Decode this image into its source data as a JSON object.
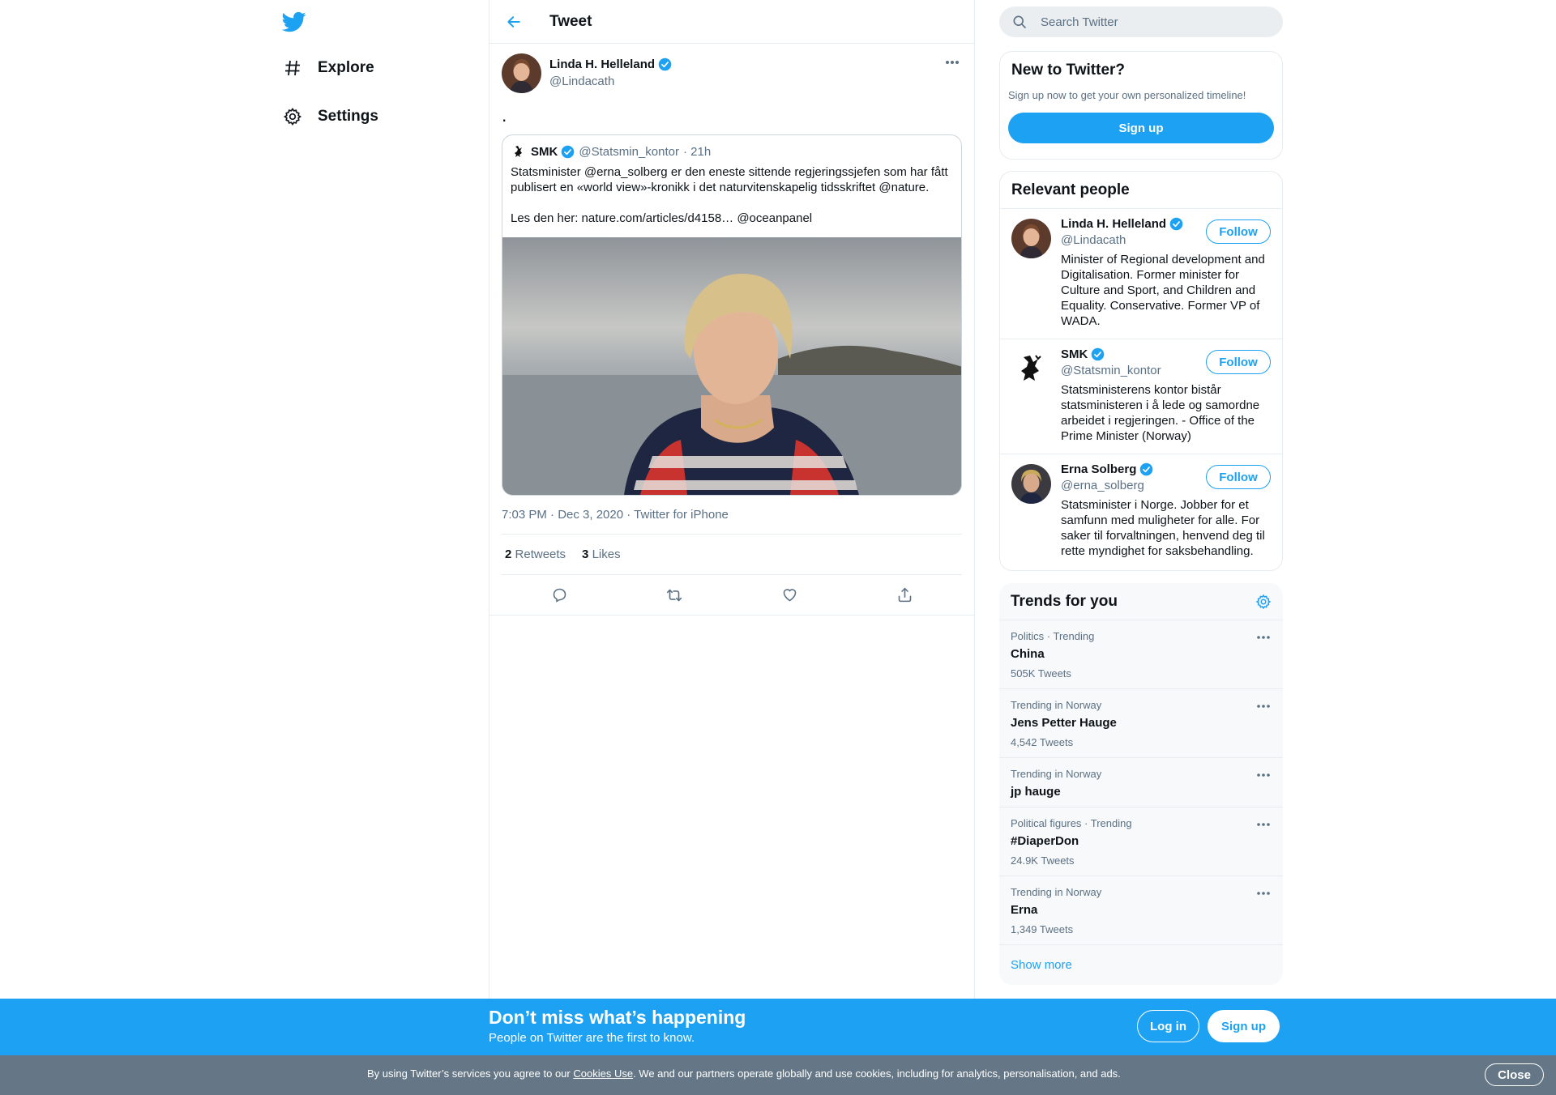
{
  "nav": {
    "logo_icon": "twitter-bird-icon",
    "items": [
      {
        "label": "Explore",
        "icon": "hashtag-icon"
      },
      {
        "label": "Settings",
        "icon": "gear-icon"
      }
    ]
  },
  "header": {
    "title": "Tweet",
    "back_icon": "arrow-left-icon"
  },
  "tweet": {
    "author_name": "Linda H. Helleland",
    "author_handle": "@Lindacath",
    "text": ".",
    "quote": {
      "name": "SMK",
      "handle": "@Statsmin_kontor",
      "time": "· 21h",
      "text_1": "Statsminister @erna_solberg er den eneste sittende regjeringssjefen som har fått publisert en «world view»-kronikk i det naturvitenskapelig tidsskriftet @nature.",
      "text_2": "Les den her: nature.com/articles/d4158… @oceanpanel"
    },
    "timestamp": "7:03 PM · Dec 3, 2020",
    "separator": "·",
    "source": "Twitter for iPhone",
    "retweets_count": "2",
    "retweets_label": "Retweets",
    "likes_count": "3",
    "likes_label": "Likes"
  },
  "search": {
    "placeholder": "Search Twitter"
  },
  "new_to_twitter": {
    "title": "New to Twitter?",
    "subtitle": "Sign up now to get your own personalized timeline!",
    "button": "Sign up"
  },
  "relevant_people": {
    "title": "Relevant people",
    "follow_label": "Follow",
    "people": [
      {
        "name": "Linda H. Helleland",
        "handle": "@Lindacath",
        "bio": "Minister of Regional development and Digitalisation. Former minister for Culture and Sport, and Children and Equality. Conservative. Former VP of WADA."
      },
      {
        "name": "SMK",
        "handle": "@Statsmin_kontor",
        "bio": "Statsministerens kontor bistår statsministeren i å lede og samordne arbeidet i regjeringen. - Office of the Prime Minister (Norway)"
      },
      {
        "name": "Erna Solberg",
        "handle": "@erna_solberg",
        "bio": "Statsminister i Norge. Jobber for et samfunn med muligheter for alle. For saker til forvaltningen, henvend deg til rette myndighet for saksbehandling."
      }
    ]
  },
  "trends": {
    "title": "Trends for you",
    "items": [
      {
        "meta": "Politics · Trending",
        "name": "China",
        "count": "505K Tweets"
      },
      {
        "meta": "Trending in Norway",
        "name": "Jens Petter Hauge",
        "count": "4,542 Tweets"
      },
      {
        "meta": "Trending in Norway",
        "name": "jp hauge",
        "count": ""
      },
      {
        "meta": "Political figures · Trending",
        "name": "#DiaperDon",
        "count": "24.9K Tweets"
      },
      {
        "meta": "Trending in Norway",
        "name": "Erna",
        "count": "1,349 Tweets"
      }
    ],
    "show_more": "Show more"
  },
  "banner": {
    "headline": "Don’t miss what’s happening",
    "subline": "People on Twitter are the first to know.",
    "login": "Log in",
    "signup": "Sign up"
  },
  "cookie": {
    "text_before": "By using Twitter’s services you agree to our ",
    "link": "Cookies Use",
    "text_after": ". We and our partners operate globally and use cookies, including for analytics, personalisation, and ads.",
    "close": "Close"
  },
  "colors": {
    "accent": "#1da1f2",
    "text": "#0f1419",
    "secondary": "#5b7083",
    "cookie_bar": "#657786"
  }
}
